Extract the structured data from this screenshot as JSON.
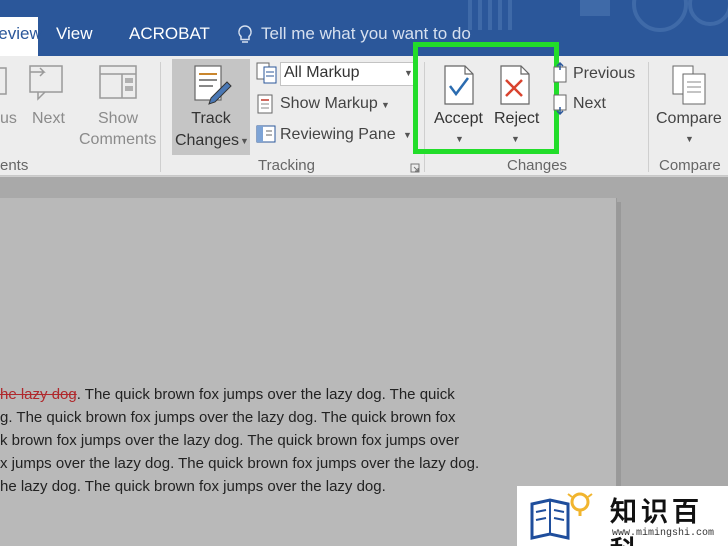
{
  "tabs": {
    "review": "Review",
    "view": "View",
    "acrobat": "ACROBAT",
    "tell_me": "Tell me what you want to do"
  },
  "ribbon": {
    "comments": {
      "previous_partial": "us",
      "next": "Next",
      "show_comments_line1": "Show",
      "show_comments_line2": "Comments",
      "group_label_partial": "ents"
    },
    "tracking": {
      "track_changes_line1": "Track",
      "track_changes_line2": "Changes",
      "markup_dropdown_value": "All Markup",
      "show_markup": "Show Markup",
      "reviewing_pane": "Reviewing Pane",
      "group_label": "Tracking"
    },
    "changes": {
      "accept": "Accept",
      "reject": "Reject",
      "previous": "Previous",
      "next": "Next",
      "group_label": "Changes"
    },
    "compare": {
      "compare": "Compare",
      "group_label": "Compare"
    }
  },
  "document": {
    "deleted_text": "he lazy dog",
    "line1_rest": ". The quick brown fox jumps over the lazy dog. The quick",
    "line2": "g. The quick brown fox jumps over the lazy dog. The quick brown fox",
    "line3": "k brown fox jumps over the lazy dog. The quick brown fox jumps over",
    "line4": "x jumps over the lazy dog. The quick brown fox jumps over the lazy dog.",
    "line5": "he lazy dog. The quick brown fox jumps over the lazy dog."
  },
  "watermark": {
    "title": "知识百科",
    "url": "www.mimingshi.com"
  },
  "colors": {
    "title_bar": "#2b579a",
    "highlight_border": "#22dd2a",
    "deleted_text": "#b0282c",
    "accept_check": "#2b6cb0",
    "reject_x": "#d9432e"
  },
  "icons": [
    "lightbulb-icon",
    "next-comment-icon",
    "show-comments-icon",
    "track-changes-icon",
    "markup-icon",
    "reviewing-pane-icon",
    "accept-icon",
    "reject-icon",
    "previous-change-icon",
    "next-change-icon",
    "compare-icon",
    "dialog-launcher-icon"
  ]
}
